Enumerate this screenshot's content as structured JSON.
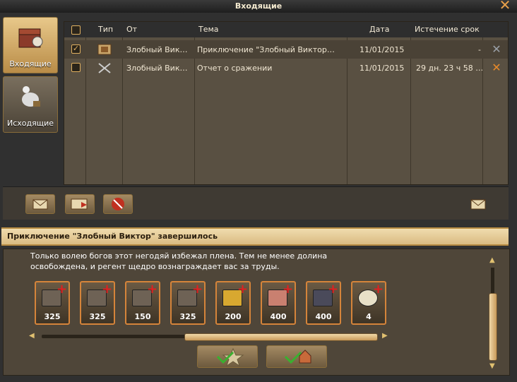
{
  "window": {
    "title": "Входящие"
  },
  "nav": {
    "inbox_label": "Входящие",
    "outbox_label": "Исходящие"
  },
  "table": {
    "columns": [
      "Тип",
      "От",
      "Тема",
      "Дата",
      "Истечение срок"
    ],
    "rows": [
      {
        "checked": true,
        "icon": "adventure-scroll-icon",
        "from": "Злобный Вик…",
        "subject": "Приключение \"Злобный Виктор…",
        "date": "11/01/2015",
        "expires": "-",
        "delete_icon": "close-icon-grey"
      },
      {
        "checked": false,
        "icon": "crossed-swords-icon",
        "from": "Злобный Вик…",
        "subject": "Отчет о сражении",
        "date": "11/01/2015",
        "expires": "29 дн. 23 ч 58 …",
        "delete_icon": "close-icon-orange"
      }
    ]
  },
  "message": {
    "subject": "Приключение \"Злобный Виктор\" завершилось",
    "body_line1": "Только волею богов этот негодяй избежал плена. Тем не менее долина",
    "body_line2": "освобождена, и регент щедро вознаграждает вас за труды.",
    "rewards": [
      {
        "icon": "building-upgrade-icon",
        "amount": "325"
      },
      {
        "icon": "building-upgrade-icon",
        "amount": "325"
      },
      {
        "icon": "building-upgrade-icon",
        "amount": "150"
      },
      {
        "icon": "building-upgrade-icon",
        "amount": "325"
      },
      {
        "icon": "gold-coins-icon",
        "amount": "200"
      },
      {
        "icon": "meat-icon",
        "amount": "400"
      },
      {
        "icon": "ore-icon",
        "amount": "400"
      },
      {
        "icon": "badge-icon",
        "amount": "4"
      }
    ]
  },
  "colors": {
    "accent": "#d5843a",
    "panel": "#595042",
    "header_band": "#e8cf9c"
  }
}
